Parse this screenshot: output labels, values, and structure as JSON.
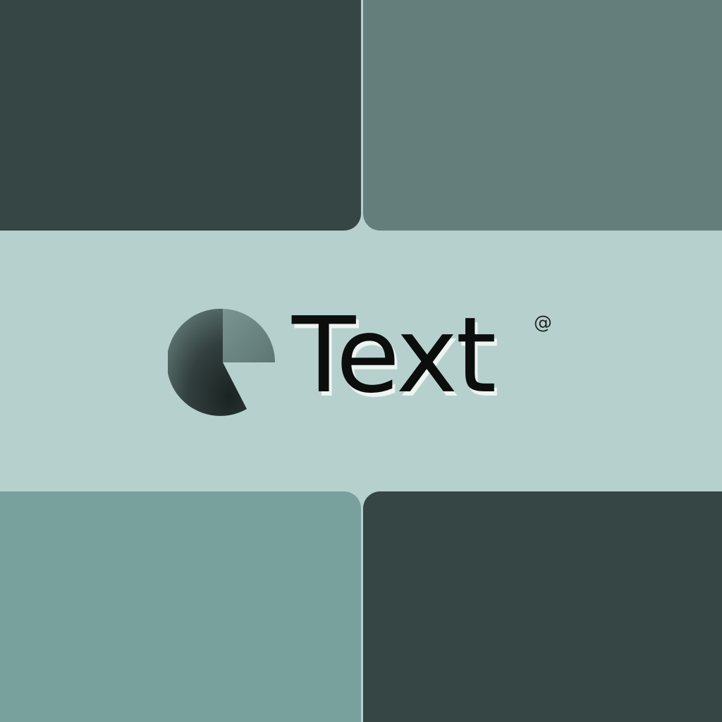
{
  "brand": {
    "wordmark": "Text",
    "registered_symbol": "@",
    "logo_icon": "pie-circle-logo-icon"
  },
  "colors": {
    "background_band": "#b6d1cd",
    "panel_top_left": "#354645",
    "panel_top_right": "#647e7c",
    "panel_bottom_left": "#78a19d",
    "panel_bottom_right": "#354645",
    "logo_dark": "#1e2a28",
    "logo_light": "#6b8683",
    "text": "#0c0d0d"
  }
}
